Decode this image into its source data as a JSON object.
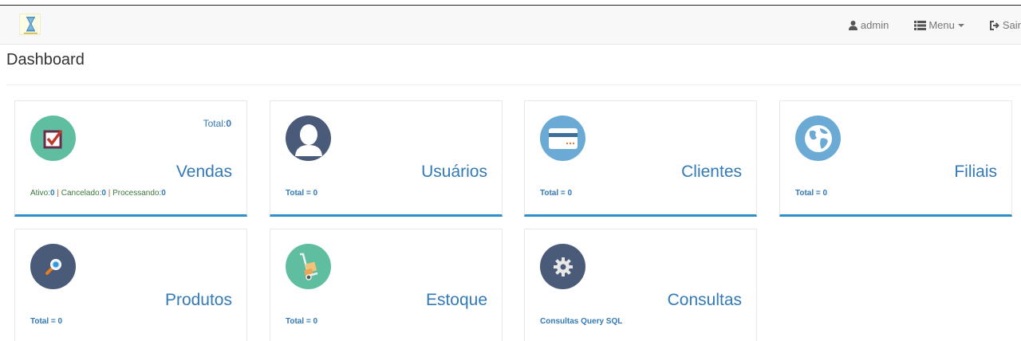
{
  "navbar": {
    "user_label": "admin",
    "menu_label": "Menu",
    "logout_label": "Sair"
  },
  "page": {
    "title": "Dashboard"
  },
  "colors": {
    "accent": "#2c8fc9",
    "link": "#337ab7",
    "icon_green": "#5fbea0",
    "icon_navy": "#4a5a79",
    "icon_blue": "#6aaad4"
  },
  "cards": {
    "vendas": {
      "title": "Vendas",
      "total_label": "Total:",
      "total_value": "0",
      "ativo_label": "Ativo:",
      "ativo_value": "0",
      "cancelado_label": "Cancelado:",
      "cancelado_value": "0",
      "processando_label": "Processando:",
      "processando_value": "0",
      "icon": "checkbox-icon"
    },
    "usuarios": {
      "title": "Usuários",
      "footer": "Total = 0",
      "icon": "user-silhouette-icon"
    },
    "clientes": {
      "title": "Clientes",
      "footer": "Total = 0",
      "icon": "credit-card-icon"
    },
    "filiais": {
      "title": "Filiais",
      "footer": "Total = 0",
      "icon": "globe-icon"
    },
    "produtos": {
      "title": "Produtos",
      "footer": "Total = 0",
      "icon": "magnifier-icon"
    },
    "estoque": {
      "title": "Estoque",
      "footer": "Total = 0",
      "icon": "hand-truck-icon"
    },
    "consultas": {
      "title": "Consultas",
      "footer": "Consultas Query SQL",
      "icon": "gear-icon"
    }
  }
}
